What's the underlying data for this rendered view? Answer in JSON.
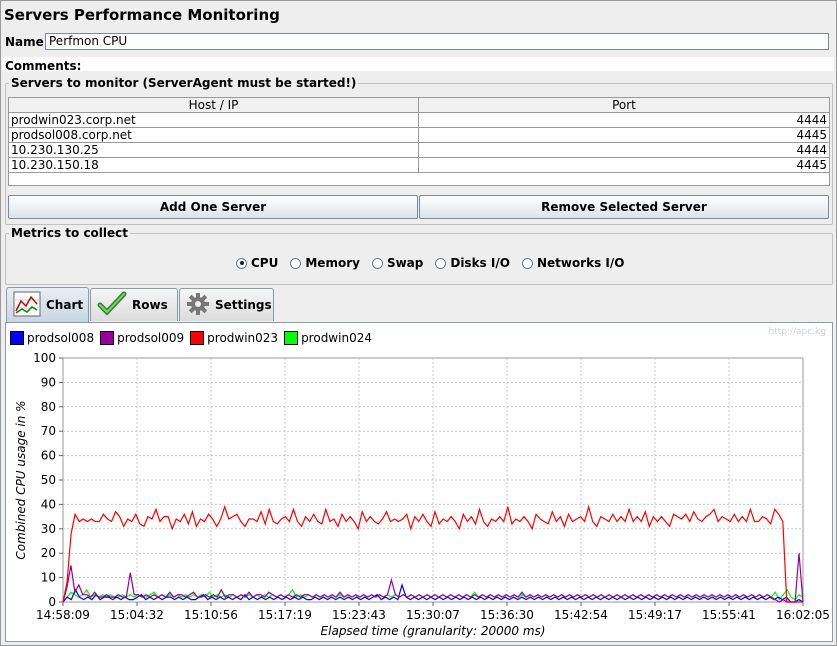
{
  "window": {
    "title": "Servers Performance Monitoring"
  },
  "form": {
    "name_label": "Name:",
    "name_value": "Perfmon CPU",
    "comments_label": "Comments:"
  },
  "servers": {
    "group_title": "Servers to monitor (ServerAgent must be started!)",
    "columns": [
      "Host / IP",
      "Port"
    ],
    "rows": [
      {
        "host": "prodwin023.corp.net",
        "port": "4444"
      },
      {
        "host": "prodsol008.corp.net",
        "port": "4445"
      },
      {
        "host": "10.230.130.25",
        "port": "4444"
      },
      {
        "host": "10.230.150.18",
        "port": "4445"
      }
    ],
    "add_button": "Add One Server",
    "remove_button": "Remove Selected Server"
  },
  "metrics": {
    "group_title": "Metrics to collect",
    "options": [
      "CPU",
      "Memory",
      "Swap",
      "Disks I/O",
      "Networks I/O"
    ],
    "selected": "CPU"
  },
  "tabs": [
    {
      "label": "Chart",
      "icon": "chart-icon",
      "active": true
    },
    {
      "label": "Rows",
      "icon": "checkmark-icon",
      "active": false
    },
    {
      "label": "Settings",
      "icon": "gear-icon",
      "active": false
    }
  ],
  "chart_data": {
    "type": "line",
    "watermark": "http://apc.kg",
    "ylabel": "Combined CPU usage in %",
    "xlabel": "Elapsed time (granularity: 20000 ms)",
    "ylim": [
      0,
      100
    ],
    "yticks": [
      0,
      10,
      20,
      30,
      40,
      50,
      60,
      70,
      80,
      90,
      100
    ],
    "xticks": [
      "14:58:09",
      "15:04:32",
      "15:10:56",
      "15:17:19",
      "15:23:43",
      "15:30:07",
      "15:36:30",
      "15:42:54",
      "15:49:17",
      "15:55:41",
      "16:02:05"
    ],
    "grid": true,
    "legend_position": "top-left",
    "series": [
      {
        "name": "prodsol008",
        "color": "#0000ff",
        "values": [
          0,
          2,
          1,
          5,
          2,
          1,
          2,
          1,
          3,
          1,
          2,
          2,
          1,
          2,
          1,
          2,
          1,
          1,
          2,
          3,
          1,
          2,
          1,
          2,
          1,
          2,
          2,
          1,
          2,
          1,
          2,
          1,
          1,
          2,
          3,
          1,
          2,
          1,
          2,
          1,
          2,
          1,
          2,
          1,
          3,
          1,
          2,
          1,
          2,
          1,
          2,
          1,
          2,
          1,
          2,
          1,
          2,
          1,
          2,
          1,
          1,
          2,
          1,
          2,
          1,
          2,
          1,
          2,
          1,
          2,
          1,
          2,
          1,
          2,
          1,
          2,
          3,
          1,
          2,
          1,
          2,
          1,
          7,
          2,
          1,
          2,
          1,
          2,
          1,
          2,
          1,
          2,
          1,
          2,
          1,
          2,
          1,
          2,
          1,
          2,
          1,
          2,
          1,
          2,
          1,
          2,
          1,
          2,
          1,
          2,
          1,
          2,
          1,
          2,
          1,
          2,
          1,
          2,
          1,
          2,
          1,
          2,
          1,
          2,
          1,
          2,
          1,
          2,
          1,
          2,
          1,
          2,
          1,
          2,
          1,
          2,
          1,
          2,
          1,
          2,
          1,
          2,
          1,
          2,
          1,
          2,
          1,
          2,
          1,
          2,
          1,
          2,
          1,
          2,
          1,
          2,
          1,
          2,
          1,
          2,
          1,
          2,
          1,
          2,
          1,
          2,
          1,
          2,
          1,
          2,
          1,
          2,
          1,
          2,
          1,
          2,
          0,
          0,
          1,
          0
        ]
      },
      {
        "name": "prodsol009",
        "color": "#990099",
        "values": [
          0,
          6,
          15,
          4,
          7,
          3,
          3,
          2,
          4,
          2,
          2,
          3,
          2,
          2,
          3,
          2,
          2,
          12,
          3,
          3,
          2,
          3,
          2,
          3,
          2,
          3,
          2,
          4,
          2,
          3,
          3,
          2,
          3,
          4,
          2,
          2,
          3,
          2,
          3,
          2,
          5,
          2,
          3,
          3,
          2,
          3,
          2,
          4,
          2,
          3,
          3,
          2,
          4,
          3,
          2,
          3,
          2,
          3,
          2,
          3,
          2,
          3,
          3,
          2,
          3,
          2,
          3,
          2,
          3,
          2,
          4,
          2,
          3,
          2,
          3,
          2,
          3,
          2,
          3,
          2,
          3,
          2,
          3,
          9,
          3,
          2,
          3,
          2,
          3,
          2,
          3,
          2,
          3,
          2,
          3,
          2,
          3,
          2,
          3,
          2,
          3,
          2,
          3,
          2,
          3,
          2,
          3,
          2,
          3,
          2,
          3,
          2,
          3,
          2,
          3,
          2,
          4,
          2,
          3,
          2,
          3,
          2,
          3,
          2,
          3,
          2,
          3,
          2,
          3,
          2,
          3,
          2,
          3,
          2,
          3,
          2,
          3,
          2,
          3,
          2,
          3,
          2,
          3,
          2,
          3,
          2,
          3,
          2,
          3,
          2,
          3,
          2,
          3,
          2,
          3,
          2,
          3,
          2,
          3,
          2,
          3,
          2,
          3,
          2,
          3,
          2,
          3,
          2,
          3,
          2,
          3,
          2,
          3,
          2,
          3,
          2,
          3,
          2,
          3,
          2,
          1,
          0,
          1,
          0,
          0,
          0,
          20,
          0
        ]
      },
      {
        "name": "prodwin023",
        "color": "#ff0000",
        "values": [
          0,
          8,
          28,
          36,
          33,
          34,
          33,
          34,
          33,
          33,
          36,
          34,
          33,
          37,
          35,
          31,
          34,
          33,
          36,
          32,
          31,
          35,
          34,
          38,
          33,
          35,
          35,
          30,
          34,
          33,
          36,
          32,
          37,
          31,
          34,
          33,
          36,
          34,
          31,
          34,
          39,
          34,
          35,
          36,
          33,
          31,
          34,
          34,
          33,
          37,
          32,
          38,
          33,
          32,
          34,
          35,
          33,
          38,
          33,
          31,
          35,
          33,
          36,
          33,
          32,
          38,
          33,
          34,
          31,
          36,
          33,
          35,
          33,
          30,
          37,
          33,
          35,
          33,
          32,
          34,
          37,
          33,
          34,
          33,
          34,
          36,
          30,
          35,
          33,
          36,
          33,
          31,
          37,
          32,
          34,
          33,
          35,
          33,
          30,
          36,
          33,
          35,
          32,
          38,
          33,
          31,
          34,
          33,
          35,
          33,
          39,
          32,
          34,
          33,
          35,
          33,
          30,
          36,
          34,
          33,
          32,
          37,
          33,
          35,
          31,
          36,
          33,
          34,
          35,
          33,
          39,
          33,
          31,
          35,
          34,
          33,
          36,
          33,
          35,
          33,
          38,
          33,
          35,
          33,
          37,
          31,
          35,
          33,
          35,
          33,
          31,
          36,
          35,
          34,
          36,
          33,
          37,
          34,
          33,
          35,
          36,
          38,
          33,
          35,
          34,
          33,
          36,
          33,
          35,
          33,
          38,
          33,
          33,
          35,
          34,
          32,
          38,
          36,
          33,
          0,
          0,
          0,
          0,
          0
        ]
      },
      {
        "name": "prodwin024",
        "color": "#00ff00",
        "values": [
          0,
          2,
          4,
          3,
          2,
          3,
          5,
          2,
          3,
          2,
          3,
          2,
          3,
          2,
          2,
          3,
          2,
          3,
          2,
          3,
          2,
          2,
          3,
          4,
          2,
          3,
          2,
          3,
          2,
          3,
          2,
          3,
          2,
          3,
          2,
          3,
          2,
          4,
          2,
          3,
          2,
          3,
          2,
          3,
          2,
          3,
          2,
          3,
          2,
          3,
          2,
          3,
          2,
          3,
          2,
          3,
          2,
          3,
          5,
          2,
          3,
          2,
          3,
          2,
          3,
          2,
          3,
          2,
          3,
          2,
          3,
          2,
          3,
          2,
          3,
          2,
          3,
          2,
          3,
          2,
          3,
          2,
          3,
          2,
          3,
          2,
          3,
          2,
          3,
          2,
          3,
          2,
          3,
          2,
          3,
          2,
          3,
          2,
          3,
          2,
          3,
          2,
          3,
          2,
          4,
          2,
          3,
          2,
          3,
          2,
          3,
          2,
          3,
          2,
          3,
          2,
          3,
          2,
          3,
          2,
          3,
          2,
          3,
          2,
          3,
          2,
          3,
          2,
          3,
          2,
          3,
          2,
          3,
          2,
          3,
          2,
          3,
          2,
          3,
          2,
          3,
          2,
          3,
          2,
          3,
          2,
          3,
          2,
          3,
          2,
          3,
          2,
          3,
          2,
          3,
          2,
          3,
          2,
          3,
          2,
          3,
          2,
          3,
          2,
          3,
          2,
          3,
          2,
          3,
          2,
          3,
          2,
          3,
          2,
          3,
          2,
          3,
          2,
          3,
          2,
          4,
          1,
          3,
          5,
          2,
          1,
          3,
          2
        ]
      }
    ]
  }
}
